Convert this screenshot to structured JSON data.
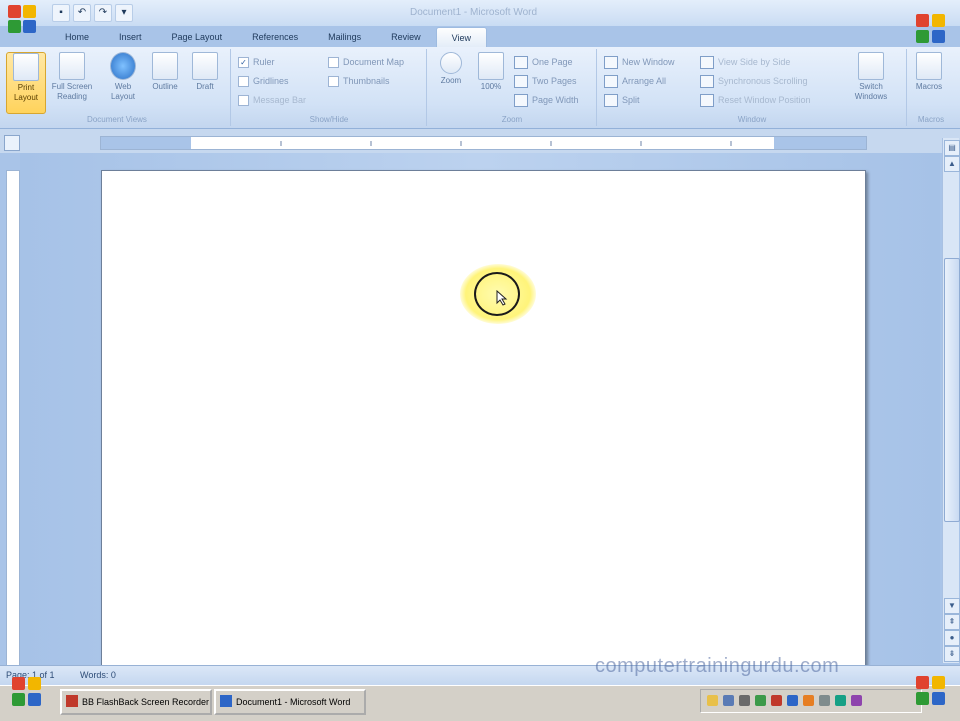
{
  "window": {
    "title": "Document1 - Microsoft Word"
  },
  "quick_access": {
    "save_icon": "save-icon",
    "undo_icon": "undo-icon",
    "redo_icon": "redo-icon"
  },
  "tabs": [
    {
      "label": "Home"
    },
    {
      "label": "Insert"
    },
    {
      "label": "Page Layout"
    },
    {
      "label": "References"
    },
    {
      "label": "Mailings"
    },
    {
      "label": "Review"
    },
    {
      "label": "View",
      "active": true
    }
  ],
  "ribbon": {
    "document_views": {
      "group_label": "Document Views",
      "print_layout": "Print Layout",
      "full_screen_reading": "Full Screen Reading",
      "web_layout": "Web Layout",
      "outline": "Outline",
      "draft": "Draft"
    },
    "show_hide": {
      "group_label": "Show/Hide",
      "ruler": "Ruler",
      "gridlines": "Gridlines",
      "message_bar": "Message Bar",
      "document_map": "Document Map",
      "thumbnails": "Thumbnails"
    },
    "zoom": {
      "group_label": "Zoom",
      "zoom": "Zoom",
      "hundred_percent": "100%",
      "one_page": "One Page",
      "two_pages": "Two Pages",
      "page_width": "Page Width"
    },
    "window": {
      "group_label": "Window",
      "new_window": "New Window",
      "arrange_all": "Arrange All",
      "split": "Split",
      "view_side_by_side": "View Side by Side",
      "synchronous_scrolling": "Synchronous Scrolling",
      "reset_window_position": "Reset Window Position",
      "switch_windows": "Switch Windows"
    },
    "macros": {
      "group_label": "Macros",
      "macros": "Macros"
    }
  },
  "status_bar": {
    "page": "Page: 1 of 1",
    "words": "Words: 0"
  },
  "watermark": "computertrainingurdu.com",
  "taskbar": {
    "buttons": [
      {
        "label": "BB FlashBack Screen Recorder"
      },
      {
        "label": "Document1 - Microsoft Word"
      }
    ]
  },
  "colors": {
    "ribbon_bg": "#d2e2f6",
    "active_button": "#ffd35c",
    "doc_background": "#a9c4e8",
    "cursor_highlight": "#fff47a"
  }
}
